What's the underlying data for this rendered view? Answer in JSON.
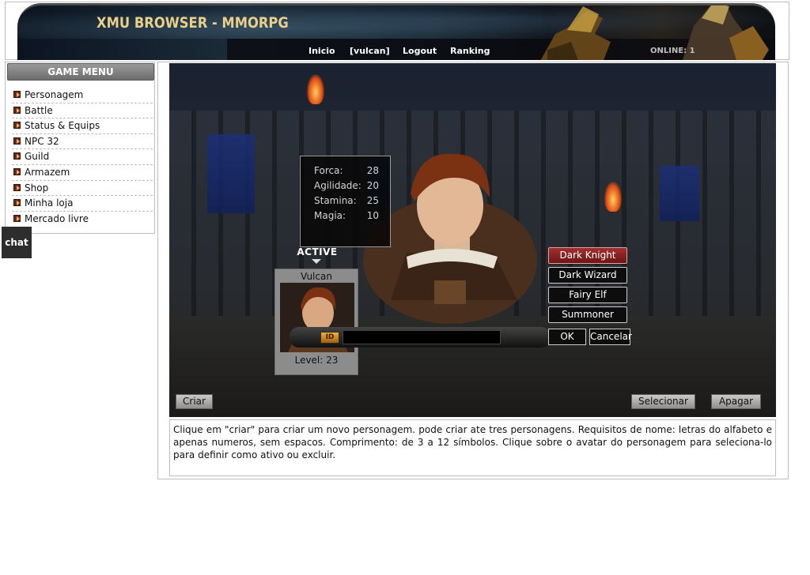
{
  "header": {
    "title": "XMU BROWSER - MMORPG",
    "nav": [
      {
        "label": "Inicio"
      },
      {
        "label": "[vulcan]"
      },
      {
        "label": "Logout"
      },
      {
        "label": "Ranking"
      }
    ],
    "online": "ONLINE: 1"
  },
  "sidebar": {
    "title": "GAME MENU",
    "items": [
      {
        "label": "Personagem"
      },
      {
        "label": "Battle"
      },
      {
        "label": "Status & Equips"
      },
      {
        "label": "NPC 32"
      },
      {
        "label": "Guild"
      },
      {
        "label": "Armazem"
      },
      {
        "label": "Shop"
      },
      {
        "label": "Minha loja"
      },
      {
        "label": "Mercado livre"
      }
    ],
    "chat_label": "chat"
  },
  "character": {
    "stats": [
      {
        "label": "Forca:",
        "value": "28"
      },
      {
        "label": "Agilidade:",
        "value": "20"
      },
      {
        "label": "Stamina:",
        "value": "25"
      },
      {
        "label": "Magia:",
        "value": "10"
      }
    ],
    "active_label": "ACTIVE",
    "name": "Vulcan",
    "level": "Level: 23"
  },
  "create_form": {
    "classes": [
      {
        "label": "Dark Knight",
        "selected": true
      },
      {
        "label": "Dark Wizard",
        "selected": false
      },
      {
        "label": "Fairy Elf",
        "selected": false
      },
      {
        "label": "Summoner",
        "selected": false
      }
    ],
    "id_tag": "ID",
    "name_value": "",
    "ok_label": "OK",
    "cancel_label": "Cancelar"
  },
  "actions": {
    "create_label": "Criar",
    "select_label": "Selecionar",
    "delete_label": "Apagar"
  },
  "info_text": "Clique em \"criar\" para criar um novo personagem. pode criar ate tres personagens. Requisitos de nome: letras do alfabeto e apenas numeros, sem espacos. Comprimento: de 3 a 12 símbolos. Clique sobre o avatar do personagem para seleciona-lo para definir como ativo ou excluir.",
  "colors": {
    "selected_class": "#a03030",
    "header_title": "#e9cf8a",
    "menu_bullet": "#6a2a10"
  }
}
